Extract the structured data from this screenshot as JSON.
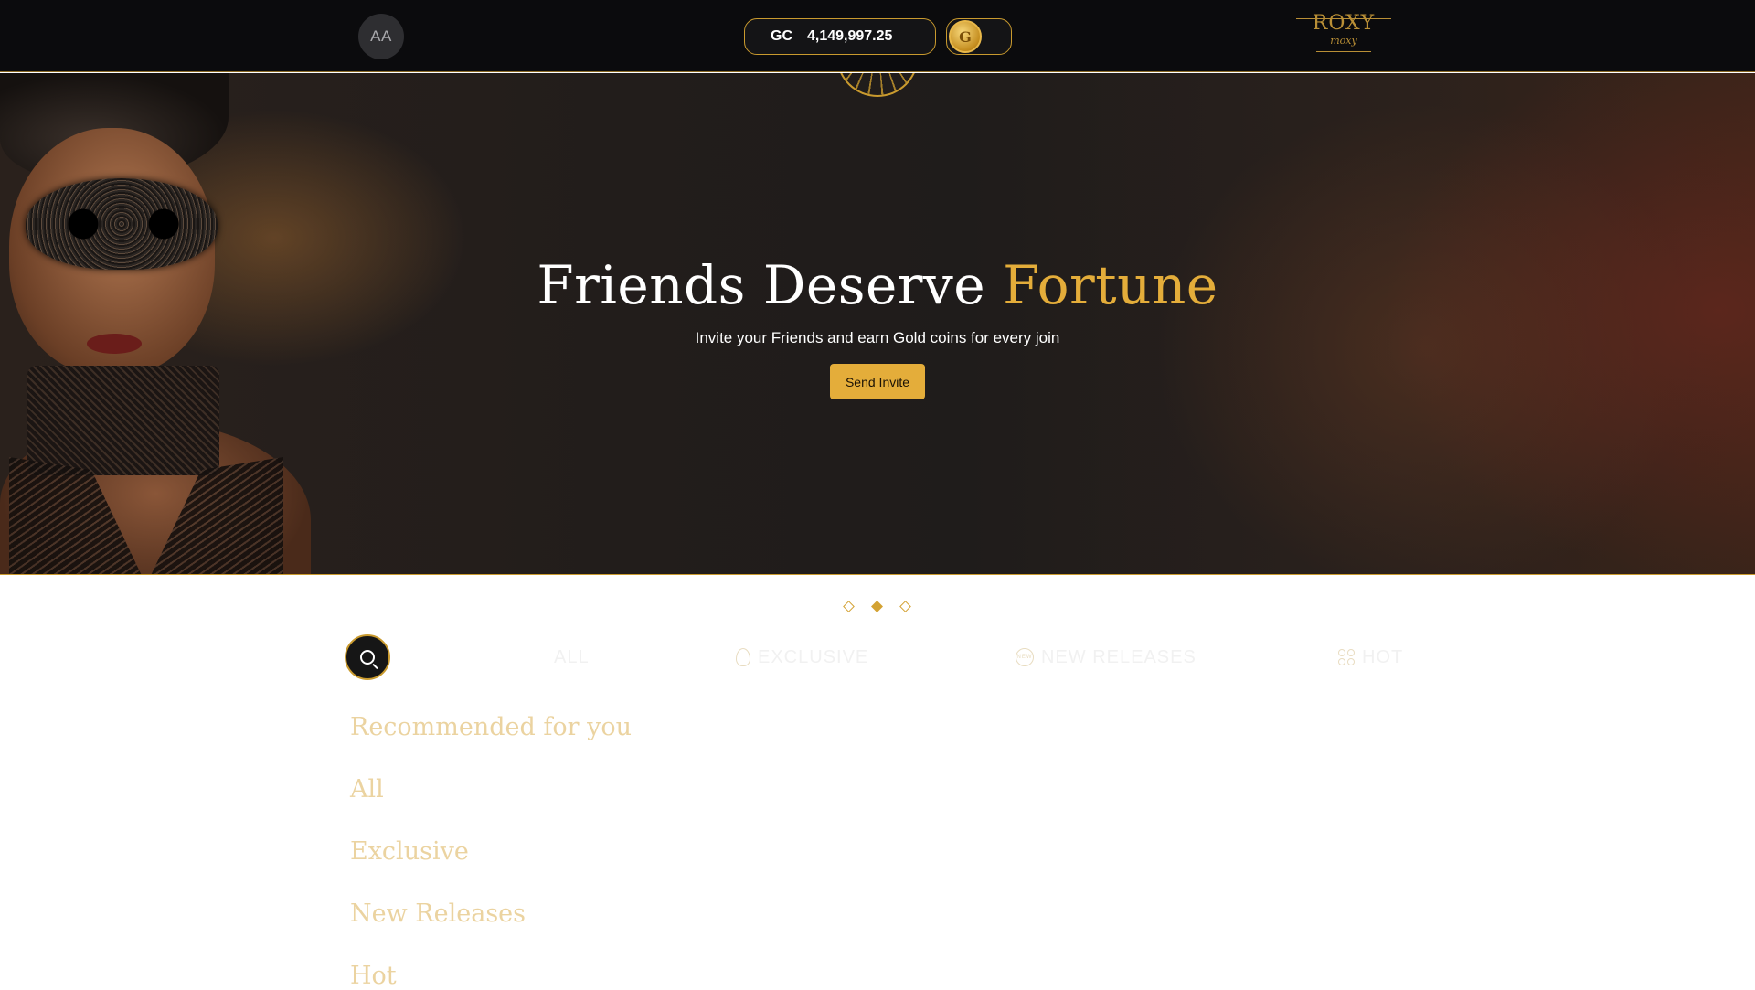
{
  "header": {
    "avatar_initials": "AA",
    "balance_currency": "GC",
    "balance_amount": "4,149,997.25",
    "coin_glyph": "G",
    "logo_top": "ROXY",
    "logo_bottom": "moxy"
  },
  "hero": {
    "title_main": "Friends Deserve ",
    "title_accent": "Fortune",
    "subtitle": "Invite your Friends and earn Gold coins for every join",
    "button_label": "Send Invite"
  },
  "carousel": {
    "slide_count": 3,
    "active_index": 1
  },
  "tabs": [
    {
      "label": "ALL",
      "icon": "none"
    },
    {
      "label": "EXCLUSIVE",
      "icon": "flame-icon"
    },
    {
      "label": "NEW RELEASES",
      "icon": "new-badge-icon",
      "icon_text": "NEW"
    },
    {
      "label": "HOT",
      "icon": "grid-icon"
    }
  ],
  "sections": [
    "Recommended for you",
    "All",
    "Exclusive",
    "New Releases",
    "Hot"
  ],
  "colors": {
    "gold": "#e4ad3a",
    "gold_border": "#c99a2e",
    "header_bg": "#0b0b0d",
    "section_text": "#ebd3a0"
  }
}
